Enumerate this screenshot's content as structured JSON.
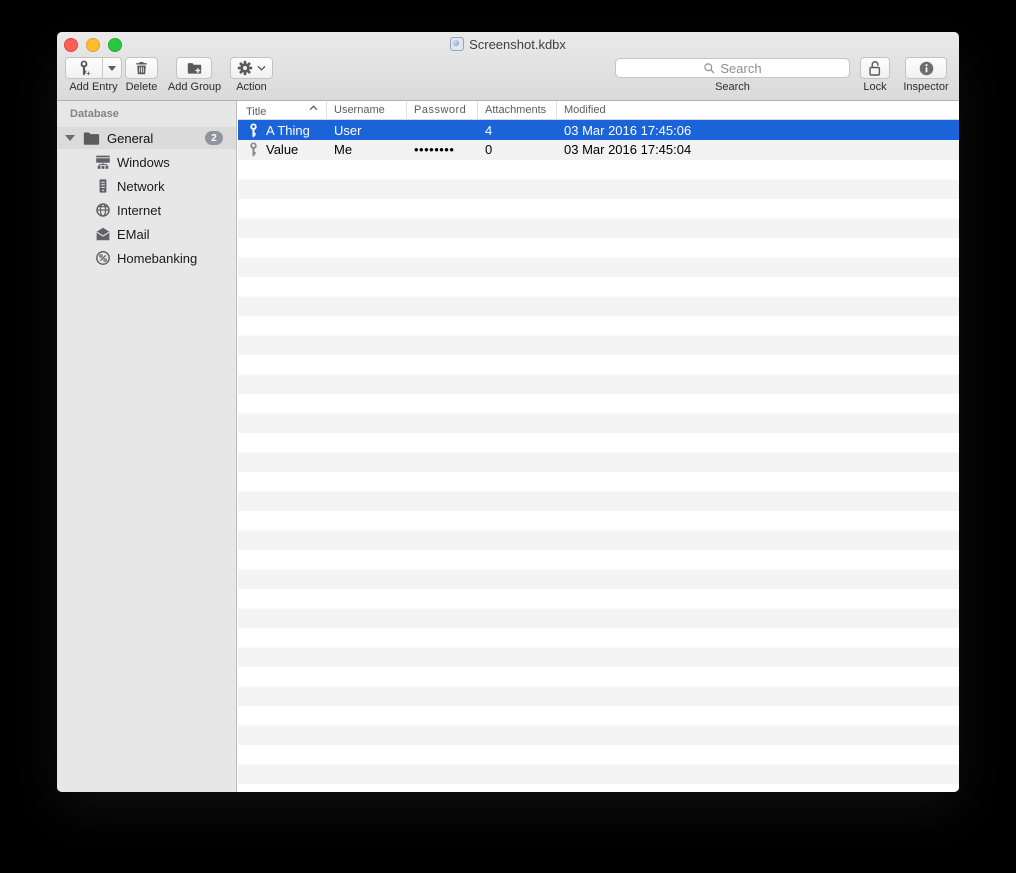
{
  "window": {
    "title": "Screenshot.kdbx"
  },
  "toolbar": {
    "add_entry_label": "Add Entry",
    "delete_label": "Delete",
    "add_group_label": "Add Group",
    "action_label": "Action",
    "search_placeholder": "Search",
    "search_label": "Search",
    "lock_label": "Lock",
    "inspector_label": "Inspector"
  },
  "sidebar": {
    "header": "Database",
    "group": {
      "label": "General",
      "badge": "2"
    },
    "items": [
      {
        "label": "Windows",
        "icon": "windows-network-icon"
      },
      {
        "label": "Network",
        "icon": "server-icon"
      },
      {
        "label": "Internet",
        "icon": "globe-icon"
      },
      {
        "label": "EMail",
        "icon": "envelope-icon"
      },
      {
        "label": "Homebanking",
        "icon": "percent-icon"
      }
    ]
  },
  "table": {
    "columns": [
      "Title",
      "Username",
      "Password",
      "Attachments",
      "Modified"
    ],
    "sort_column": "Title",
    "sort_direction": "ascending",
    "rows": [
      {
        "title": "A Thing",
        "username": "User",
        "password": "",
        "attachments": "4",
        "modified": "03 Mar 2016 17:45:06",
        "selected": true
      },
      {
        "title": "Value",
        "username": "Me",
        "password": "••••••••",
        "attachments": "0",
        "modified": "03 Mar 2016 17:45:04",
        "selected": false
      }
    ]
  },
  "colors": {
    "selection_blue": "#1b63d9",
    "stripe_gray": "#f4f4f5",
    "sidebar_gray": "#e7e7e7"
  }
}
